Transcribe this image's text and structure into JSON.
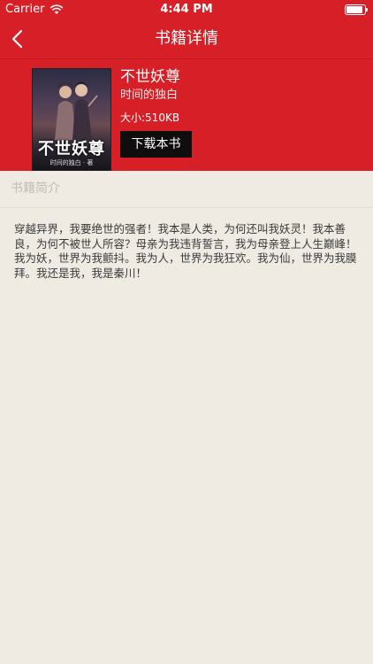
{
  "status_bar": {
    "carrier": "Carrier",
    "time": "4:44 PM"
  },
  "nav": {
    "title": "书籍详情",
    "back_icon": "chevron-left-icon"
  },
  "book": {
    "cover_title": "不世妖尊",
    "cover_author": "时间的独白 · 著",
    "title": "不世妖尊",
    "author": "时间的独白",
    "size": "大小:510KB",
    "download_label": "下载本书"
  },
  "section": {
    "title": "书籍简介"
  },
  "intro": "穿越异界，我要绝世的强者！我本是人类，为何还叫我妖灵！我本善良，为何不被世人所容？母亲为我违背誓言，我为母亲登上人生巅峰！我为妖，世界为我颤抖。我为人，世界为我狂欢。我为仙，世界为我膜拜。我还是我，我是秦川！",
  "colors": {
    "brand_red": "#D61F26",
    "background": "#EFEBE3",
    "button_black": "#0F0D0D"
  }
}
